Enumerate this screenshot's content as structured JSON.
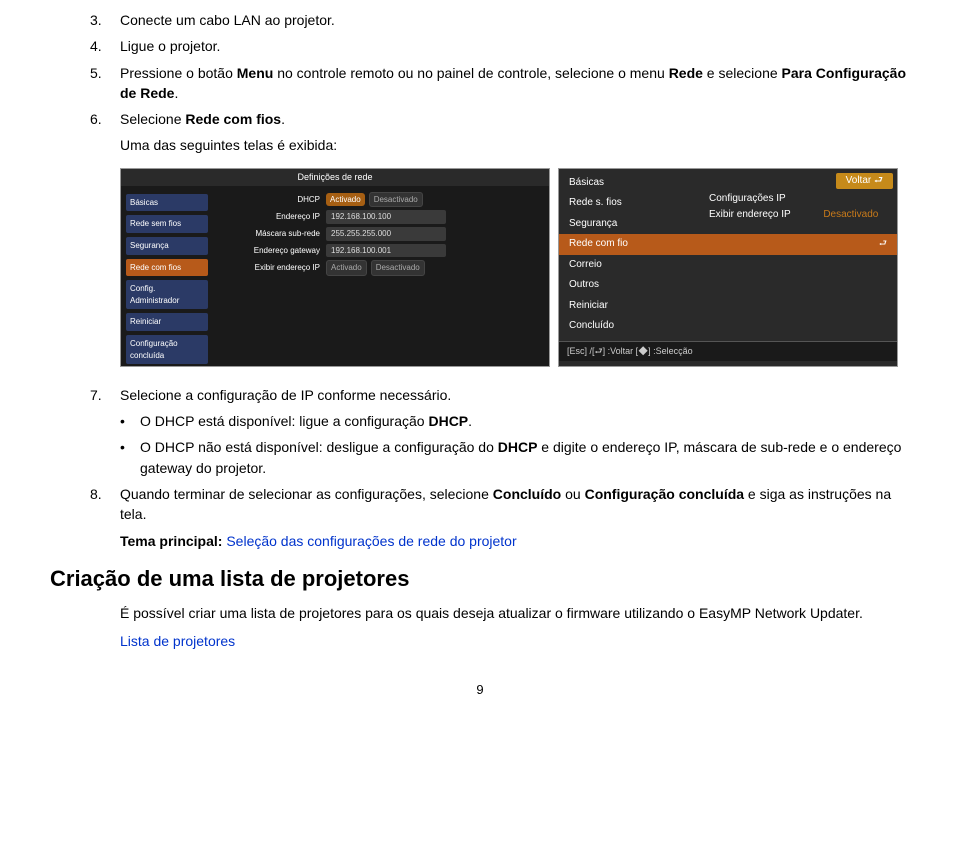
{
  "steps": {
    "s3": {
      "num": "3.",
      "text_a": "Conecte um cabo LAN ao projetor."
    },
    "s4": {
      "num": "4.",
      "text_a": "Ligue o projetor."
    },
    "s5": {
      "num": "5.",
      "text_a": "Pressione o botão ",
      "bold_a": "Menu",
      "text_b": " no controle remoto ou no painel de controle, selecione o menu ",
      "bold_b": "Rede",
      "text_c": " e selecione ",
      "bold_c": "Para Configuração de Rede",
      "text_d": "."
    },
    "s6": {
      "num": "6.",
      "text_a": "Selecione ",
      "bold_a": "Rede com fios",
      "text_b": ".",
      "sub": "Uma das seguintes telas é exibida:"
    },
    "s7": {
      "num": "7.",
      "text_a": "Selecione a configuração de IP conforme necessário."
    },
    "s8": {
      "num": "8.",
      "text_a": "Quando terminar de selecionar as configurações, selecione ",
      "bold_a": "Concluído",
      "text_b": " ou ",
      "bold_b": "Configuração concluída",
      "text_c": " e siga as instruções na tela."
    }
  },
  "bullets": {
    "b1": {
      "text_a": "O DHCP está disponível: ligue a configuração ",
      "bold_a": "DHCP",
      "text_b": "."
    },
    "b2": {
      "text_a": "O DHCP não está disponível: desligue a configuração do ",
      "bold_a": "DHCP",
      "text_b": " e digite o endereço IP, máscara de sub-rede e o endereço gateway do projetor."
    }
  },
  "theme": {
    "label": "Tema principal: ",
    "link": "Seleção das configurações de rede do projetor"
  },
  "section_title": "Criação de uma lista de projetores",
  "section_body": "É possível criar uma lista de projetores para os quais deseja atualizar o firmware utilizando o EasyMP Network Updater.",
  "section_link": "Lista de projetores",
  "page_number": "9",
  "scr1": {
    "title": "Definições de rede",
    "side": {
      "i0": "Básicas",
      "i1": "Rede sem fios",
      "i2": "Segurança",
      "i3": "Rede com fios",
      "i4": "Config. Administrador",
      "i5": "Reiniciar",
      "i6": "Configuração concluída"
    },
    "rows": {
      "dhcp_lbl": "DHCP",
      "dhcp_on": "Activado",
      "dhcp_off": "Desactivado",
      "ip_lbl": "Endereço IP",
      "ip_val": "192.168.100.100",
      "mask_lbl": "Máscara sub-rede",
      "mask_val": "255.255.255.000",
      "gw_lbl": "Endereço gateway",
      "gw_val": "192.168.100.001",
      "show_lbl": "Exibir endereço IP",
      "show_on": "Activado",
      "show_off": "Desactivado"
    }
  },
  "scr2": {
    "voltar": "Voltar  ⮐",
    "items": {
      "i0": "Básicas",
      "i1": "Rede s. fios",
      "i2": "Segurança",
      "i3": "Rede com fio",
      "i3sym": "⮐",
      "i4": "Correio",
      "i5": "Outros",
      "i6": "Reiniciar",
      "i7": "Concluído"
    },
    "right": {
      "r0": "Configurações IP",
      "r1": "Exibir endereço IP",
      "r1v": "Desactivado"
    },
    "footer": "[Esc] /[⮐] :Voltar   [◆] :Selecção"
  }
}
